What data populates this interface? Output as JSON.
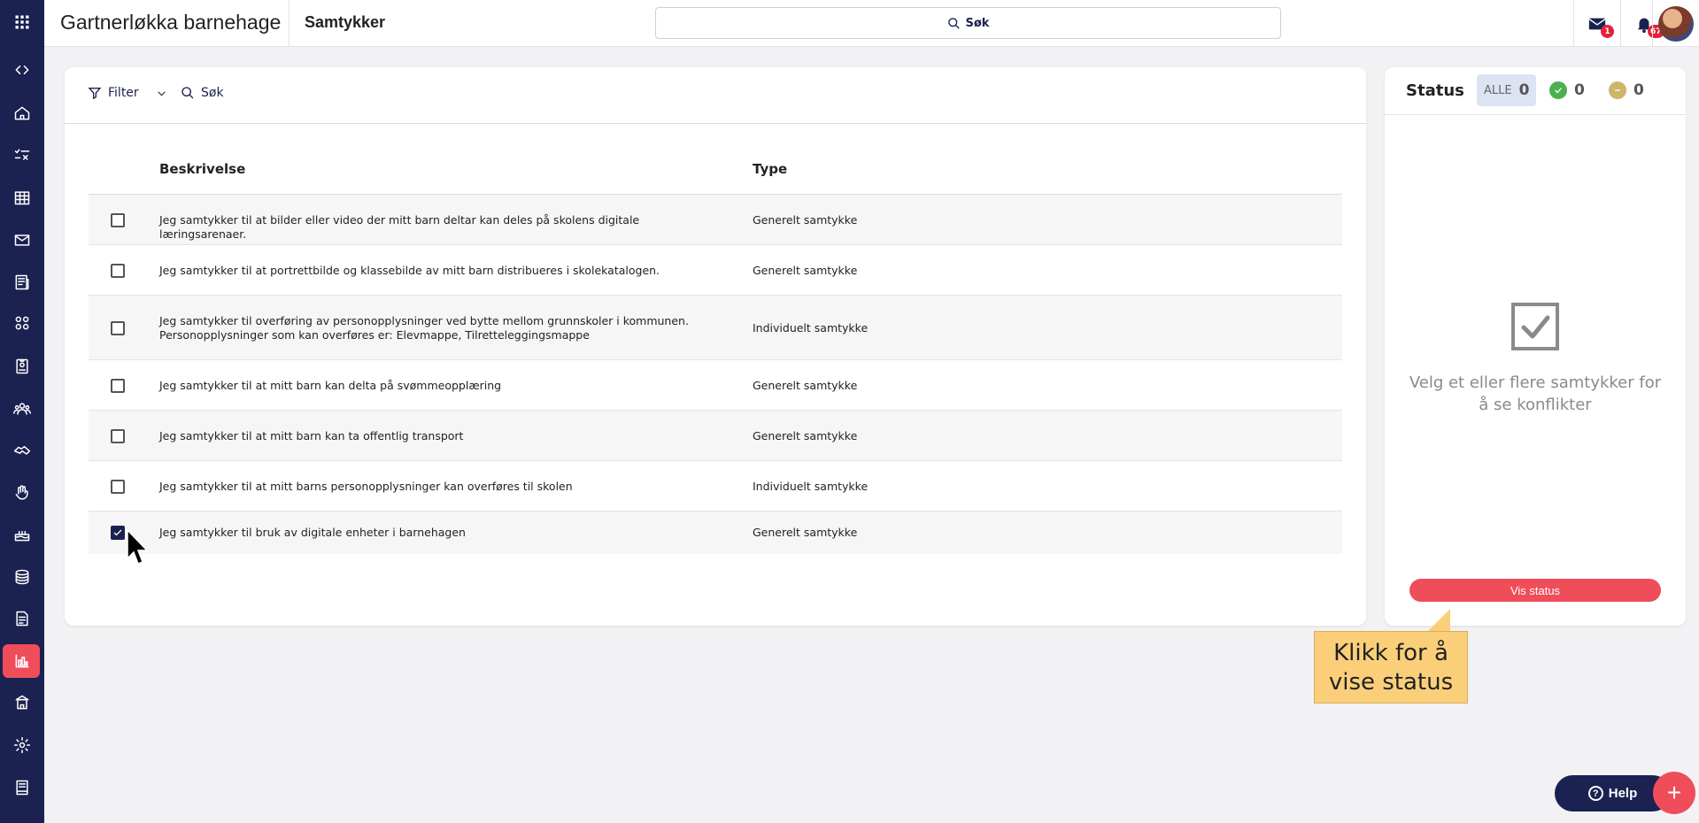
{
  "app": {
    "org_name": "Gartnerløkka barnehage",
    "page_title": "Samtykker",
    "search_label": "Søk",
    "messages_badge": "1",
    "notifications_badge": "67"
  },
  "sidebar": {
    "items": [
      {
        "icon": "apps-grid-icon",
        "active": false
      },
      {
        "icon": "code-brackets-icon",
        "active": false
      },
      {
        "icon": "home-icon",
        "active": false
      },
      {
        "icon": "tasks-icon",
        "active": false
      },
      {
        "icon": "calendar-icon",
        "active": false
      },
      {
        "icon": "mail-icon",
        "active": false
      },
      {
        "icon": "news-icon",
        "active": false
      },
      {
        "icon": "groups-icon",
        "active": false
      },
      {
        "icon": "badge-icon",
        "active": false
      },
      {
        "icon": "people-icon",
        "active": false
      },
      {
        "icon": "handshake-icon",
        "active": false
      },
      {
        "icon": "hand-icon",
        "active": false
      },
      {
        "icon": "cake-icon",
        "active": false
      },
      {
        "icon": "coins-icon",
        "active": false
      },
      {
        "icon": "document-icon",
        "active": false
      },
      {
        "icon": "chart-icon",
        "active": true
      },
      {
        "icon": "school-icon",
        "active": false
      },
      {
        "icon": "settings-icon",
        "active": false
      },
      {
        "icon": "book-icon",
        "active": false
      }
    ]
  },
  "toolbar": {
    "filter_label": "Filter",
    "search_label": "Søk"
  },
  "table": {
    "headers": {
      "description": "Beskrivelse",
      "type": "Type"
    },
    "rows": [
      {
        "description": "Jeg samtykker til at bilder eller video der mitt barn deltar kan deles på skolens digitale læringsarenaer.",
        "type": "Generelt samtykke",
        "checked": false
      },
      {
        "description": "Jeg samtykker til at portrettbilde og klassebilde av mitt barn distribueres i skolekatalogen.",
        "type": "Generelt samtykke",
        "checked": false
      },
      {
        "description": "Jeg samtykker til overføring av personopplysninger ved bytte mellom grunnskoler i kommunen. Personopplysninger som kan overføres er: Elevmappe, Tilretteleggingsmappe",
        "type": "Individuelt samtykke",
        "checked": false
      },
      {
        "description": "Jeg samtykker til at mitt barn kan delta på svømmeopplæring",
        "type": "Generelt samtykke",
        "checked": false
      },
      {
        "description": "Jeg samtykker til at mitt barn kan ta offentlig transport",
        "type": "Generelt samtykke",
        "checked": false
      },
      {
        "description": "Jeg samtykker til at mitt barns personopplysninger kan overføres til skolen",
        "type": "Individuelt samtykke",
        "checked": false
      },
      {
        "description": "Jeg samtykker til bruk av digitale enheter i barnehagen",
        "type": "Generelt samtykke",
        "checked": true
      }
    ]
  },
  "status": {
    "title": "Status",
    "all_label": "ALLE",
    "all_count": "0",
    "approved_count": "0",
    "declined_count": "0",
    "empty_message": "Velg et eller flere samtykker for å se konflikter",
    "show_button": "Vis status"
  },
  "callout": {
    "text": "Klikk for å vise status"
  },
  "footer": {
    "help_label": "Help",
    "add_label": "+"
  },
  "colors": {
    "navy": "#1b2150",
    "accent": "#ef4d5a",
    "approved": "#4cb050",
    "declined": "#cdb56a",
    "callout": "#fbcf7a"
  }
}
